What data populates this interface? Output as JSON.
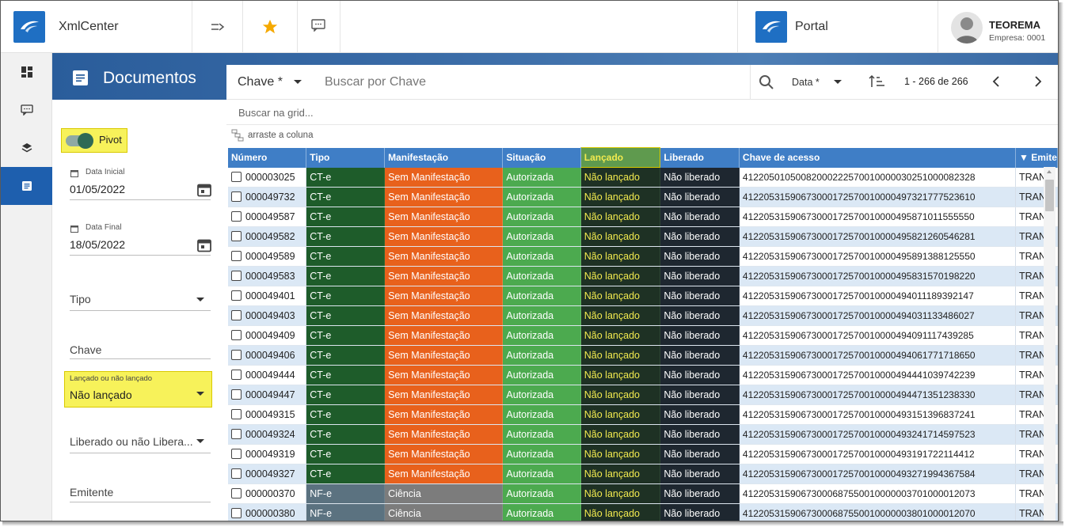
{
  "header": {
    "app_title": "XmlCenter",
    "portal_label": "Portal",
    "user_name": "TEOREMA",
    "company": "Empresa: 0001"
  },
  "page": {
    "title": "Documentos"
  },
  "filters": {
    "pivot_label": "Pivot",
    "pivot_on": true,
    "data_inicial_label": "Data Inicial",
    "data_inicial_value": "01/05/2022",
    "data_final_label": "Data Final",
    "data_final_value": "18/05/2022",
    "tipo_label": "Tipo",
    "chave_label": "Chave",
    "lancado_label": "Lançado ou não lançado",
    "lancado_value": "Não lançado",
    "liberado_label": "Liberado ou não Libera...",
    "emitente_label": "Emitente"
  },
  "search": {
    "field_select": "Chave *",
    "placeholder": "Buscar por Chave",
    "sort_select": "Data *",
    "pagination": "1 - 266 de 266",
    "grid_search_placeholder": "Buscar na grid...",
    "drag_hint": "arraste a coluna"
  },
  "grid": {
    "columns": [
      "Número",
      "Tipo",
      "Manifestação",
      "Situação",
      "Lançado",
      "Liberado",
      "Chave de acesso",
      "Emite"
    ],
    "rows": [
      {
        "numero": "000003025",
        "tipo": "CT-e",
        "manifestacao": "Sem Manifestação",
        "situacao": "Autorizada",
        "lancado": "Não lançado",
        "liberado": "Não liberado",
        "chave": "41220501050082000222570010000030251000082328",
        "emitente": "TRAN"
      },
      {
        "numero": "000049732",
        "tipo": "CT-e",
        "manifestacao": "Sem Manifestação",
        "situacao": "Autorizada",
        "lancado": "Não lançado",
        "liberado": "Não liberado",
        "chave": "41220531590673000172570010000497321777523610",
        "emitente": "TRAN"
      },
      {
        "numero": "000049587",
        "tipo": "CT-e",
        "manifestacao": "Sem Manifestação",
        "situacao": "Autorizada",
        "lancado": "Não lançado",
        "liberado": "Não liberado",
        "chave": "41220531590673000172570010000495871011555550",
        "emitente": "TRAN"
      },
      {
        "numero": "000049582",
        "tipo": "CT-e",
        "manifestacao": "Sem Manifestação",
        "situacao": "Autorizada",
        "lancado": "Não lançado",
        "liberado": "Não liberado",
        "chave": "41220531590673000172570010000495821260546281",
        "emitente": "TRAN"
      },
      {
        "numero": "000049589",
        "tipo": "CT-e",
        "manifestacao": "Sem Manifestação",
        "situacao": "Autorizada",
        "lancado": "Não lançado",
        "liberado": "Não liberado",
        "chave": "41220531590673000172570010000495891388125550",
        "emitente": "TRAN"
      },
      {
        "numero": "000049583",
        "tipo": "CT-e",
        "manifestacao": "Sem Manifestação",
        "situacao": "Autorizada",
        "lancado": "Não lançado",
        "liberado": "Não liberado",
        "chave": "41220531590673000172570010000495831570198220",
        "emitente": "TRAN"
      },
      {
        "numero": "000049401",
        "tipo": "CT-e",
        "manifestacao": "Sem Manifestação",
        "situacao": "Autorizada",
        "lancado": "Não lançado",
        "liberado": "Não liberado",
        "chave": "41220531590673000172570010000494011189392147",
        "emitente": "TRAN"
      },
      {
        "numero": "000049403",
        "tipo": "CT-e",
        "manifestacao": "Sem Manifestação",
        "situacao": "Autorizada",
        "lancado": "Não lançado",
        "liberado": "Não liberado",
        "chave": "41220531590673000172570010000494031133486027",
        "emitente": "TRAN"
      },
      {
        "numero": "000049409",
        "tipo": "CT-e",
        "manifestacao": "Sem Manifestação",
        "situacao": "Autorizada",
        "lancado": "Não lançado",
        "liberado": "Não liberado",
        "chave": "41220531590673000172570010000494091117439285",
        "emitente": "TRAN"
      },
      {
        "numero": "000049406",
        "tipo": "CT-e",
        "manifestacao": "Sem Manifestação",
        "situacao": "Autorizada",
        "lancado": "Não lançado",
        "liberado": "Não liberado",
        "chave": "41220531590673000172570010000494061771718650",
        "emitente": "TRAN"
      },
      {
        "numero": "000049444",
        "tipo": "CT-e",
        "manifestacao": "Sem Manifestação",
        "situacao": "Autorizada",
        "lancado": "Não lançado",
        "liberado": "Não liberado",
        "chave": "41220531590673000172570010000494441039742239",
        "emitente": "TRAN"
      },
      {
        "numero": "000049447",
        "tipo": "CT-e",
        "manifestacao": "Sem Manifestação",
        "situacao": "Autorizada",
        "lancado": "Não lançado",
        "liberado": "Não liberado",
        "chave": "41220531590673000172570010000494471351238330",
        "emitente": "TRAN"
      },
      {
        "numero": "000049315",
        "tipo": "CT-e",
        "manifestacao": "Sem Manifestação",
        "situacao": "Autorizada",
        "lancado": "Não lançado",
        "liberado": "Não liberado",
        "chave": "41220531590673000172570010000493151396837241",
        "emitente": "TRAN"
      },
      {
        "numero": "000049324",
        "tipo": "CT-e",
        "manifestacao": "Sem Manifestação",
        "situacao": "Autorizada",
        "lancado": "Não lançado",
        "liberado": "Não liberado",
        "chave": "41220531590673000172570010000493241714597523",
        "emitente": "TRAN"
      },
      {
        "numero": "000049319",
        "tipo": "CT-e",
        "manifestacao": "Sem Manifestação",
        "situacao": "Autorizada",
        "lancado": "Não lançado",
        "liberado": "Não liberado",
        "chave": "41220531590673000172570010000493191722114412",
        "emitente": "TRAN"
      },
      {
        "numero": "000049327",
        "tipo": "CT-e",
        "manifestacao": "Sem Manifestação",
        "situacao": "Autorizada",
        "lancado": "Não lançado",
        "liberado": "Não liberado",
        "chave": "41220531590673000172570010000493271994367584",
        "emitente": "TRAN"
      },
      {
        "numero": "000000370",
        "tipo": "NF-e",
        "manifestacao": "Ciência",
        "situacao": "Autorizada",
        "lancado": "Não lançado",
        "liberado": "Não liberado",
        "chave": "41220531590673000687550010000003701000012073",
        "emitente": "TRAN"
      },
      {
        "numero": "000000380",
        "tipo": "NF-e",
        "manifestacao": "Ciência",
        "situacao": "Autorizada",
        "lancado": "Não lançado",
        "liberado": "Não liberado",
        "chave": "41220531590673000687550010000003801000012070",
        "emitente": "TRAN"
      }
    ]
  },
  "colors": {
    "brand_blue": "#1f6fc3",
    "header_blue": "#3f7ec6",
    "highlight_yellow": "#f7f25a",
    "cte_green": "#1e5c2a",
    "manifestacao_orange": "#e8611c",
    "autorizada_green": "#4caa4f",
    "lancado_dark": "#1e3124",
    "liberado_dark": "#1e2730"
  },
  "icons": {
    "nav": [
      "dashboard-icon",
      "chat-icon",
      "layers-icon",
      "document-icon"
    ],
    "header": [
      "logo-icon",
      "menu-arrow-icon",
      "star-icon",
      "message-icon",
      "avatar-icon"
    ]
  }
}
